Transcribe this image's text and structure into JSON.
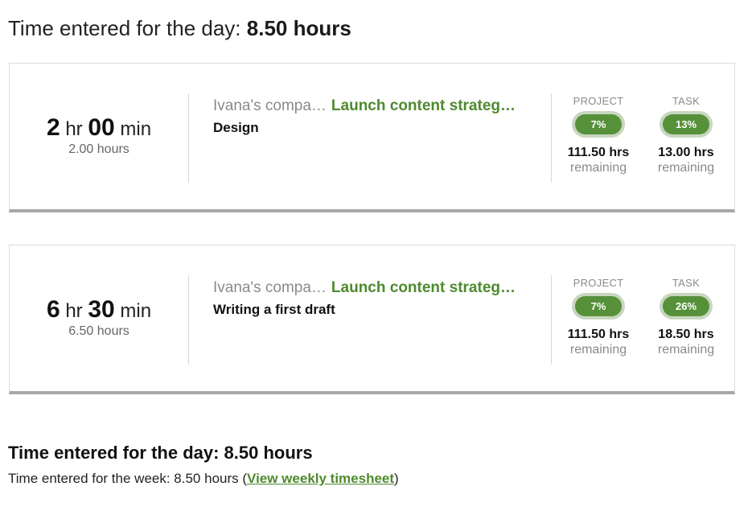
{
  "header": {
    "label": "Time entered for the day:",
    "value": "8.50 hours"
  },
  "entries": [
    {
      "hours_num": "2",
      "hr_unit": "hr",
      "minutes_num": "00",
      "min_unit": "min",
      "decimal_hours": "2.00 hours",
      "company": "Ivana's compa…",
      "project": "Launch content strateg…",
      "task": "Design",
      "project_label": "PROJECT",
      "project_percent": "7%",
      "project_remaining": "111.50 hrs",
      "task_label": "TASK",
      "task_percent": "13%",
      "task_remaining": "13.00 hrs",
      "remaining_label": "remaining"
    },
    {
      "hours_num": "6",
      "hr_unit": "hr",
      "minutes_num": "30",
      "min_unit": "min",
      "decimal_hours": "6.50 hours",
      "company": "Ivana's compa…",
      "project": "Launch content strateg…",
      "task": "Writing a first draft",
      "project_label": "PROJECT",
      "project_percent": "7%",
      "project_remaining": "111.50 hrs",
      "task_label": "TASK",
      "task_percent": "26%",
      "task_remaining": "18.50 hrs",
      "remaining_label": "remaining"
    }
  ],
  "footer": {
    "day_total": "Time entered for the day: 8.50 hours",
    "week_prefix": "Time entered for the week: 8.50 hours (",
    "week_link": "View weekly timesheet",
    "week_suffix": ")"
  },
  "colors": {
    "accent_green": "#4e8a2e",
    "pill_green": "#56913a",
    "muted_gray": "#8a8a8a"
  }
}
